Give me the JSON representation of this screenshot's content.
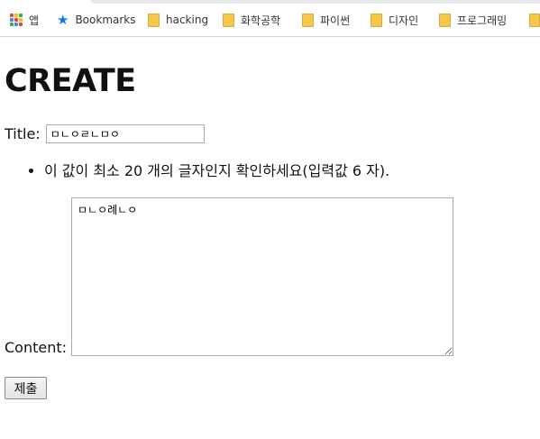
{
  "bookmarks_bar": {
    "items": [
      {
        "label": "앱",
        "icon": "apps-grid-icon"
      },
      {
        "label": "Bookmarks",
        "icon": "star-icon"
      },
      {
        "label": "hacking",
        "icon": "folder-icon"
      },
      {
        "label": "화학공학",
        "icon": "folder-icon"
      },
      {
        "label": "파이썬",
        "icon": "folder-icon"
      },
      {
        "label": "디자인",
        "icon": "folder-icon"
      },
      {
        "label": "프로그래밍",
        "icon": "folder-icon"
      }
    ]
  },
  "form": {
    "heading": "CREATE",
    "title_label": "Title:",
    "title_value": "ㅁㄴㅇㄹㄴㅁㅇ",
    "hint": "이 값이 최소 20 개의 글자인지 확인하세요(입력값 6 자).",
    "content_label": "Content:",
    "content_value": "ㅁㄴㅇ례ㄴㅇ",
    "submit_label": "제출"
  },
  "colors": {
    "star": "#1a73e8",
    "folder": "#f5c84c"
  }
}
